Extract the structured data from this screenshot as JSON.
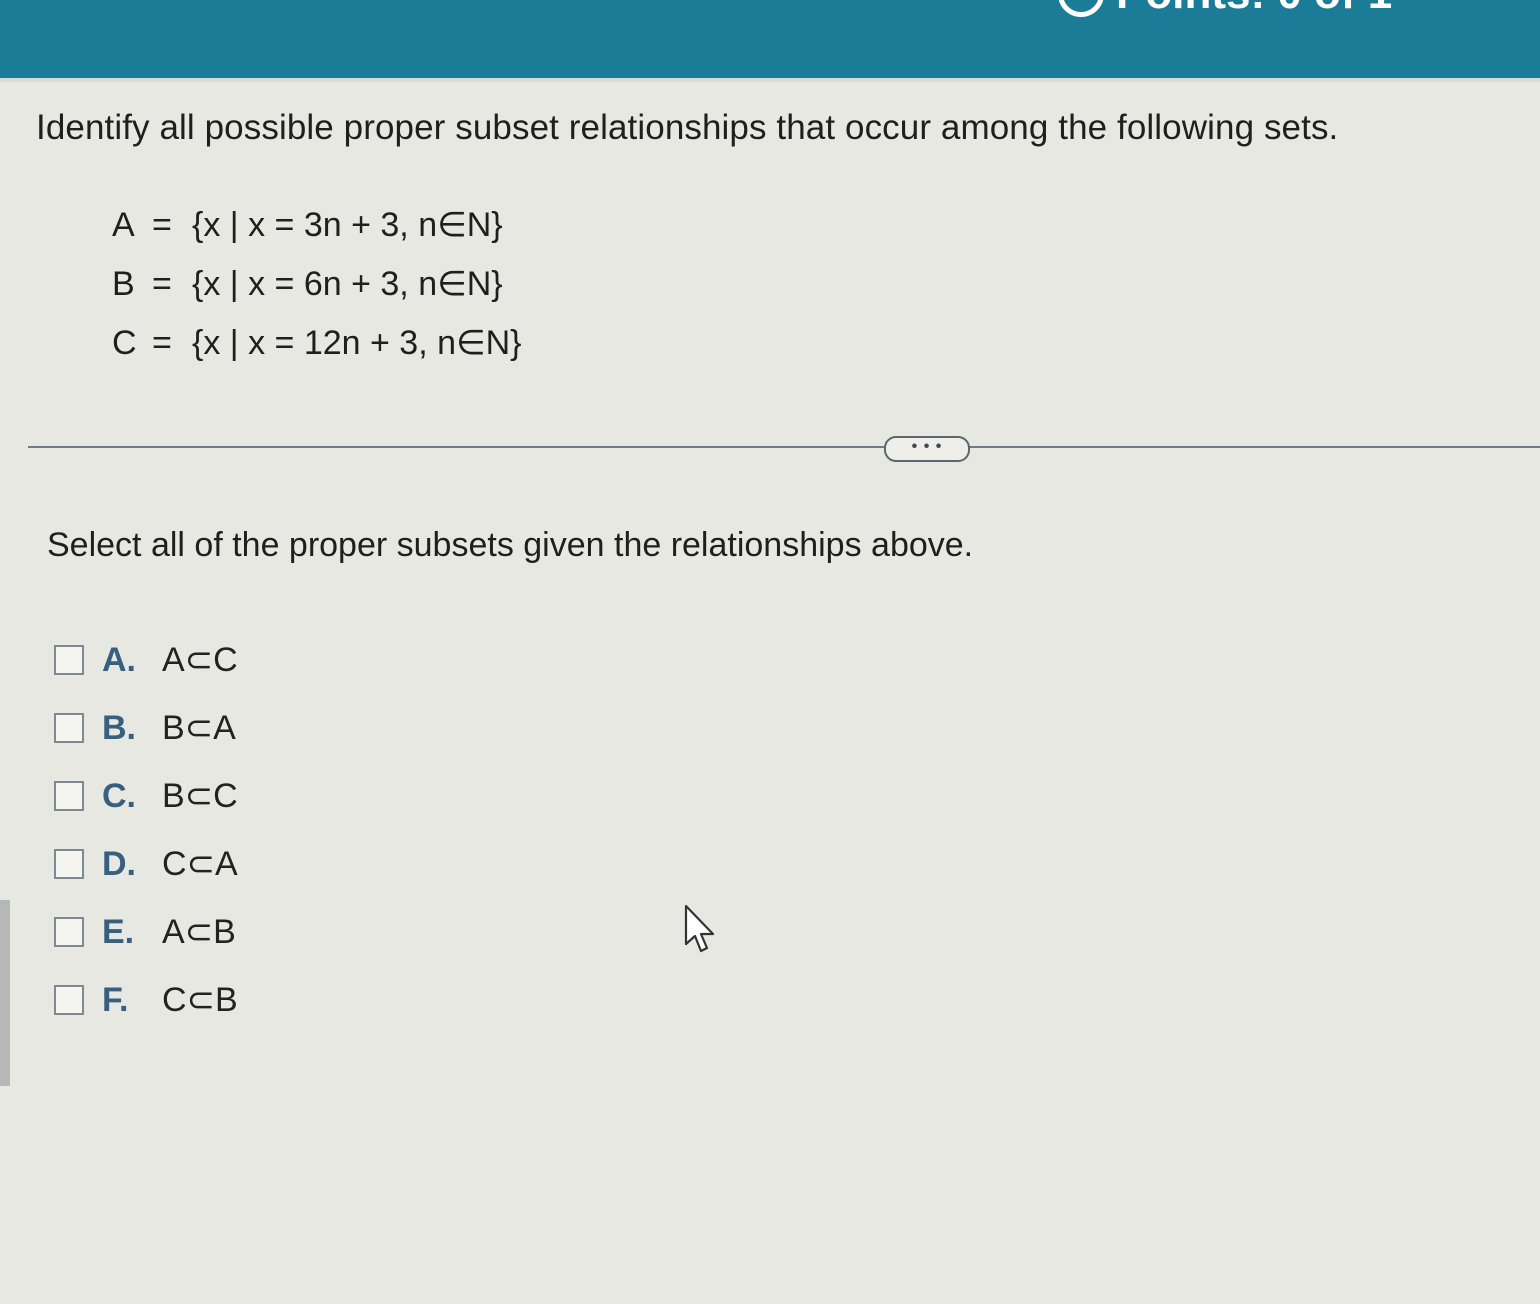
{
  "header": {
    "partial_text": "Points: 0 of 1"
  },
  "question": {
    "prompt": "Identify all possible proper subset relationships that occur among the following sets.",
    "sets": [
      {
        "name": "A",
        "equals": "=",
        "definition": "{x | x = 3n + 3, n∈N}"
      },
      {
        "name": "B",
        "equals": "=",
        "definition": "{x | x = 6n + 3, n∈N}"
      },
      {
        "name": "C",
        "equals": "=",
        "definition": "{x | x = 12n + 3, n∈N}"
      }
    ]
  },
  "divider": {
    "more_label": "• • •"
  },
  "instruction": "Select all of the proper subsets given the relationships above.",
  "options": [
    {
      "letter": "A.",
      "text": "A⊂C",
      "checked": false
    },
    {
      "letter": "B.",
      "text": "B⊂A",
      "checked": false
    },
    {
      "letter": "C.",
      "text": "B⊂C",
      "checked": false
    },
    {
      "letter": "D.",
      "text": "C⊂A",
      "checked": false
    },
    {
      "letter": "E.",
      "text": "A⊂B",
      "checked": false
    },
    {
      "letter": "F.",
      "text": "C⊂B",
      "checked": false
    }
  ],
  "colors": {
    "header": "#1b7c97",
    "background": "#e8e8e3",
    "option_letter": "#365f80"
  },
  "icons": {
    "cursor": "mouse-pointer-icon",
    "header": "progress-circle-icon"
  }
}
